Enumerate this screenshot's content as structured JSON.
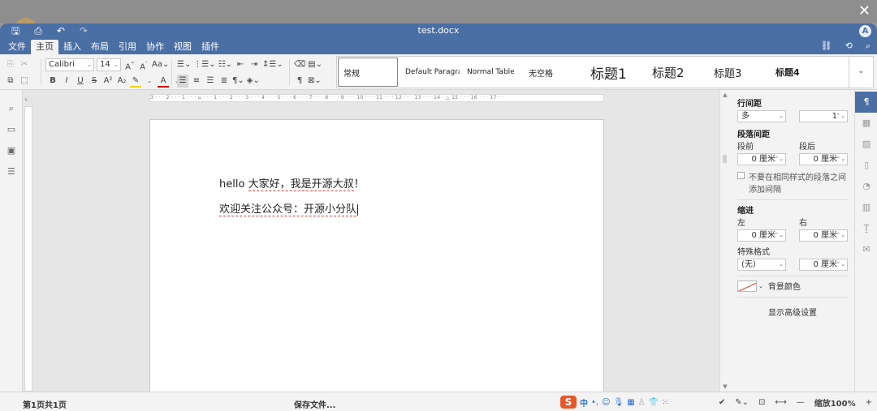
{
  "overlay": {
    "close_glyph": "✕"
  },
  "titlebar": {
    "doc_title": "test.docx",
    "quick_access": [
      "save-icon",
      "print-icon",
      "undo-icon",
      "redo-icon"
    ],
    "user_initial": "A"
  },
  "menu": {
    "tabs": [
      "文件",
      "主页",
      "插入",
      "布局",
      "引用",
      "协作",
      "视图",
      "插件"
    ],
    "active": "主页",
    "right_icons": [
      "link-icon",
      "history-icon",
      "search-icon"
    ]
  },
  "ribbon": {
    "font_name": "Calibri",
    "font_size": "14",
    "styles": [
      "常规",
      "Default Paragraj",
      "Normal Table",
      "无空格",
      "标题1",
      "标题2",
      "标题3",
      "标题4"
    ],
    "selected_style": "常规"
  },
  "document": {
    "line1_a": "hello",
    "line1_b": "大家好，我是开源大叔",
    "line1_c": "！",
    "line2": "欢迎关注公众号：开源小分队"
  },
  "ruler": {
    "h_marks": "3 · · · 2 · · · 1 · · · ⌂ · · · 1 · · · 2 · · · 3 · · · 4 · · · 5 · · · 6 · · · 7 · · · 8 · · · 9 · · · 10 · · · 11 · · · 12 · · · 13 · · · 14 · △ 15 · · · 16 · · · 17 · ·"
  },
  "paragraph_panel": {
    "line_spacing_label": "行间距",
    "line_spacing_mode": "多",
    "line_spacing_value": "1",
    "para_spacing_label": "段落间距",
    "before_label": "段前",
    "after_label": "段后",
    "before_value": "0 厘米",
    "after_value": "0 厘米",
    "no_space_same_style": "不要在相同样式的段落之间添加间隔",
    "indent_label": "缩进",
    "left_label": "左",
    "right_label": "右",
    "left_value": "0 厘米",
    "right_value": "0 厘米",
    "special_label": "特殊格式",
    "special_value": "(无)",
    "special_amount": "0 厘米",
    "bg_color_label": "背景颜色",
    "advanced_link": "显示高级设置"
  },
  "statusbar": {
    "page_info": "第1页共1页",
    "saving": "保存文件...",
    "ime_label": "中",
    "zoom": "缩放100%",
    "zoom_minus": "—",
    "zoom_plus": "+"
  }
}
